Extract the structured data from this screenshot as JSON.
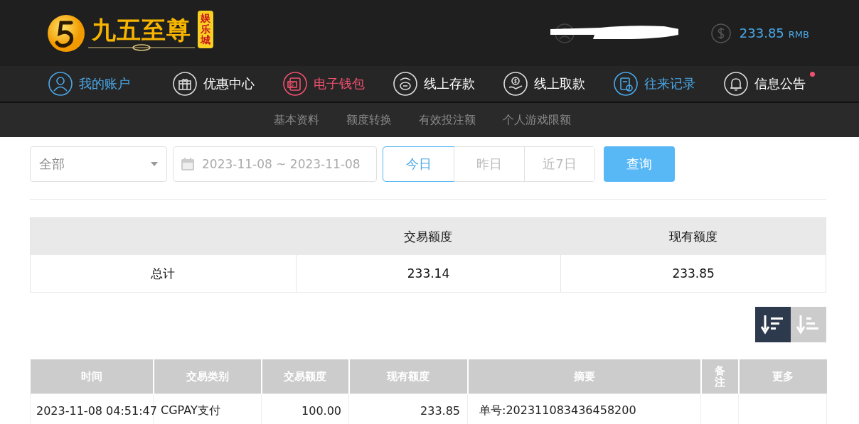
{
  "logo": {
    "name": "九五至尊",
    "tag": "娱乐城"
  },
  "account": {
    "balance": "233.85",
    "currency": "RMB"
  },
  "nav": [
    {
      "label": "我的账户",
      "color": "#4aa8e8"
    },
    {
      "label": "优惠中心",
      "color": "#ffffff"
    },
    {
      "label": "电子钱包",
      "color": "#f0506e"
    },
    {
      "label": "线上存款",
      "color": "#ffffff"
    },
    {
      "label": "线上取款",
      "color": "#ffffff"
    },
    {
      "label": "往来记录",
      "color": "#4aa8e8"
    },
    {
      "label": "信息公告",
      "color": "#ffffff",
      "badge": true
    }
  ],
  "subnav": [
    "基本资料",
    "额度转换",
    "有效投注额",
    "个人游戏限额"
  ],
  "filters": {
    "type": "全部",
    "date_range": "2023-11-08 ~ 2023-11-08",
    "ranges": [
      {
        "label": "今日",
        "selected": true
      },
      {
        "label": "昨日",
        "selected": false
      },
      {
        "label": "近7日",
        "selected": false
      }
    ],
    "query": "查询"
  },
  "summary": {
    "columns": [
      "",
      "交易额度",
      "现有额度"
    ],
    "rows": [
      [
        "总计",
        "233.14",
        "233.85"
      ]
    ]
  },
  "sort": [
    {
      "kind": "desc",
      "selected": true
    },
    {
      "kind": "asc",
      "selected": false
    }
  ],
  "table": {
    "columns": [
      "时间",
      "交易类别",
      "交易额度",
      "现有额度",
      "摘要",
      "备注",
      "更多"
    ],
    "rows": [
      [
        "2023-11-08 04:51:47",
        "CGPAY支付",
        "100.00",
        "233.85",
        "单号:202311083436458200",
        "",
        ""
      ]
    ]
  }
}
